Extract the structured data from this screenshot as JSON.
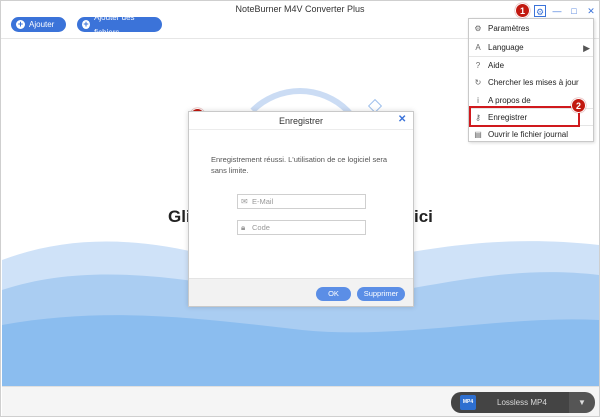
{
  "window": {
    "title": "NoteBurner M4V Converter Plus"
  },
  "toolbar": {
    "add_label": "Ajouter",
    "add_files_label": "Ajouter des fichiers"
  },
  "window_controls": {
    "gear": "⚙",
    "minimize": "—",
    "maximize": "□",
    "close": "✕"
  },
  "badges": {
    "one": "1",
    "two": "2",
    "three": "3"
  },
  "menu": {
    "items": [
      {
        "label": "Paramètres",
        "icon": "gear-icon",
        "glyph": "⚙"
      },
      {
        "label": "Language",
        "icon": "language-icon",
        "glyph": "A"
      },
      {
        "label": "Aide",
        "icon": "help-icon",
        "glyph": "?"
      },
      {
        "label": "Chercher les mises à jour",
        "icon": "refresh-icon",
        "glyph": "↻"
      },
      {
        "label": "A propos de",
        "icon": "info-icon",
        "glyph": "i"
      },
      {
        "label": "Enregistrer",
        "icon": "key-icon",
        "glyph": "⚷"
      },
      {
        "label": "Ouvrir le fichier journal",
        "icon": "log-file-icon",
        "glyph": "▤"
      }
    ],
    "submenu_arrow": "▶"
  },
  "hero": {
    "text_left": "Gli",
    "text_right": "ici"
  },
  "dialog": {
    "title": "Enregistrer",
    "close": "✕",
    "message": "Enregistrement réussi. L'utilisation de ce logiciel sera sans limite.",
    "email_placeholder": "E-Mail",
    "code_placeholder": "Code",
    "ok_label": "OK",
    "register_label": "Supprimer"
  },
  "footer": {
    "format_icon": "MP4",
    "format_label": "Lossless MP4",
    "dropdown": "▼"
  },
  "colors": {
    "accent": "#3b73d9",
    "badge": "#c2180f",
    "wave": "#bcd7f4"
  }
}
